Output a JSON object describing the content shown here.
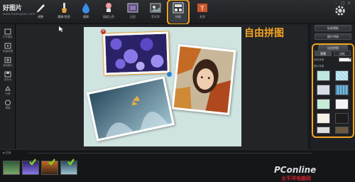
{
  "app": {
    "logo_text": "好图片",
    "logo_sub": "www.haotupian.com"
  },
  "toolbar": {
    "tools": [
      {
        "label": "调整",
        "icon": "pencil-icon"
      },
      {
        "label": "魔棒/抠图",
        "icon": "brush-icon"
      },
      {
        "label": "模糊",
        "icon": "droplet-icon"
      },
      {
        "label": "局部上色",
        "icon": "stamp-icon"
      },
      {
        "label": "日历",
        "icon": "frame-icon"
      },
      {
        "label": "写大字",
        "icon": "image-icon"
      },
      {
        "label": "拼图",
        "icon": "collage-icon",
        "active": true
      },
      {
        "label": "文字",
        "icon": "text-icon"
      }
    ]
  },
  "leftnav": {
    "items": [
      {
        "label": "打开图片",
        "icon": "open-file-icon"
      },
      {
        "label": "批量处理",
        "icon": "batch-icon"
      },
      {
        "label": "添加图片",
        "icon": "add-image-icon"
      },
      {
        "label": "另存为",
        "icon": "save-icon"
      },
      {
        "label": "分享",
        "icon": "share-icon"
      },
      {
        "label": "帮助",
        "icon": "help-icon"
      }
    ]
  },
  "annotation": {
    "title": "自由拼图"
  },
  "rightpanel": {
    "buttons": [
      "标准模板",
      "图片拼接"
    ],
    "section_header": "自由拼图",
    "tabs": [
      "背景",
      "边框"
    ],
    "rows": [
      "纯色背景",
      "图片背景"
    ],
    "accent_color": "#f5a521"
  },
  "bottom": {
    "strip_label": "◄ 已选",
    "thumb_count": 4
  },
  "watermark": {
    "main": "PConline",
    "sub": "太平洋电脑网"
  }
}
